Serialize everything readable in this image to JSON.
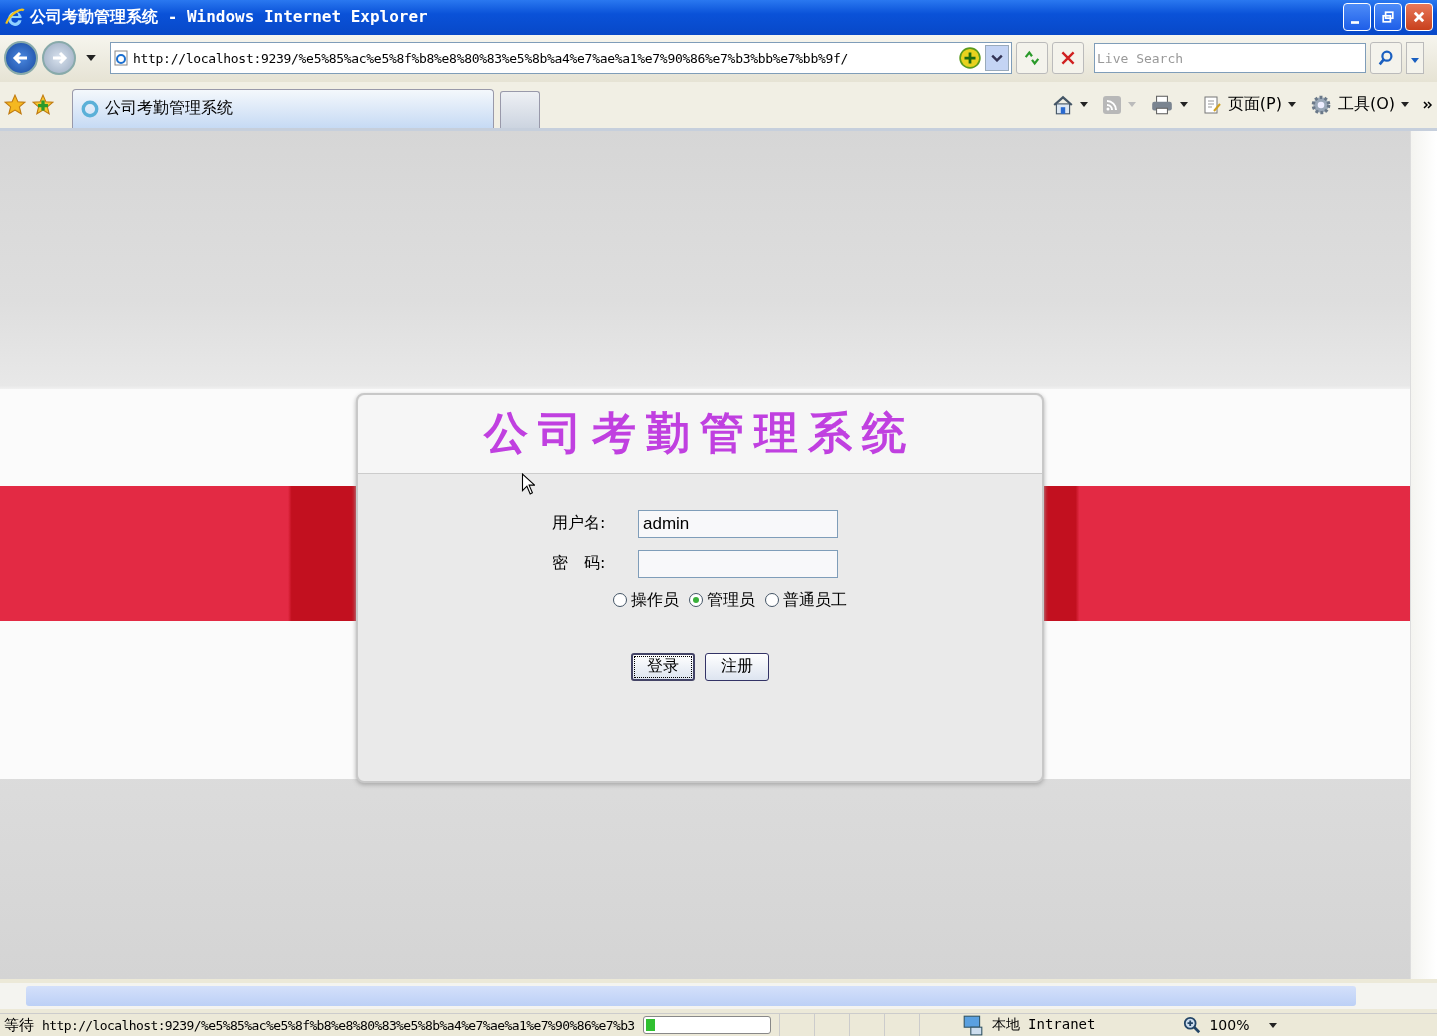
{
  "window": {
    "title": "公司考勤管理系统 - Windows Internet Explorer"
  },
  "address_bar": {
    "url": "http://localhost:9239/%e5%85%ac%e5%8f%b8%e8%80%83%e5%8b%a4%e7%ae%a1%e7%90%86%e7%b3%bb%e7%bb%9f/"
  },
  "search": {
    "placeholder": "Live Search"
  },
  "tabs": [
    {
      "label": "公司考勤管理系统",
      "selected": true
    }
  ],
  "command_bar": [
    {
      "kind": "home"
    },
    {
      "kind": "feed"
    },
    {
      "kind": "print"
    },
    {
      "kind": "page",
      "label": "页面(P)"
    },
    {
      "kind": "tools",
      "label": "工具(O)"
    }
  ],
  "login": {
    "title": "公司考勤管理系统",
    "username_label": "用户名:",
    "username": "admin",
    "password_label": "密　码:",
    "roles": [
      {
        "label": "操作员",
        "selected": false
      },
      {
        "label": "管理员",
        "selected": true
      },
      {
        "label": "普通员工",
        "selected": false
      }
    ],
    "buttons": [
      {
        "label": "登录",
        "focused": true
      },
      {
        "label": "注册",
        "focused": false
      }
    ]
  },
  "status_bar": {
    "status": "等待",
    "url": "http://localhost:9239/%e5%85%ac%e5%8f%b8%e8%80%83%e5%8b%a4%e7%ae%a1%e7%90%86%e7%b3",
    "progress": {
      "level": 0.08
    },
    "zone": "本地 Intranet",
    "zoom": "100%"
  }
}
